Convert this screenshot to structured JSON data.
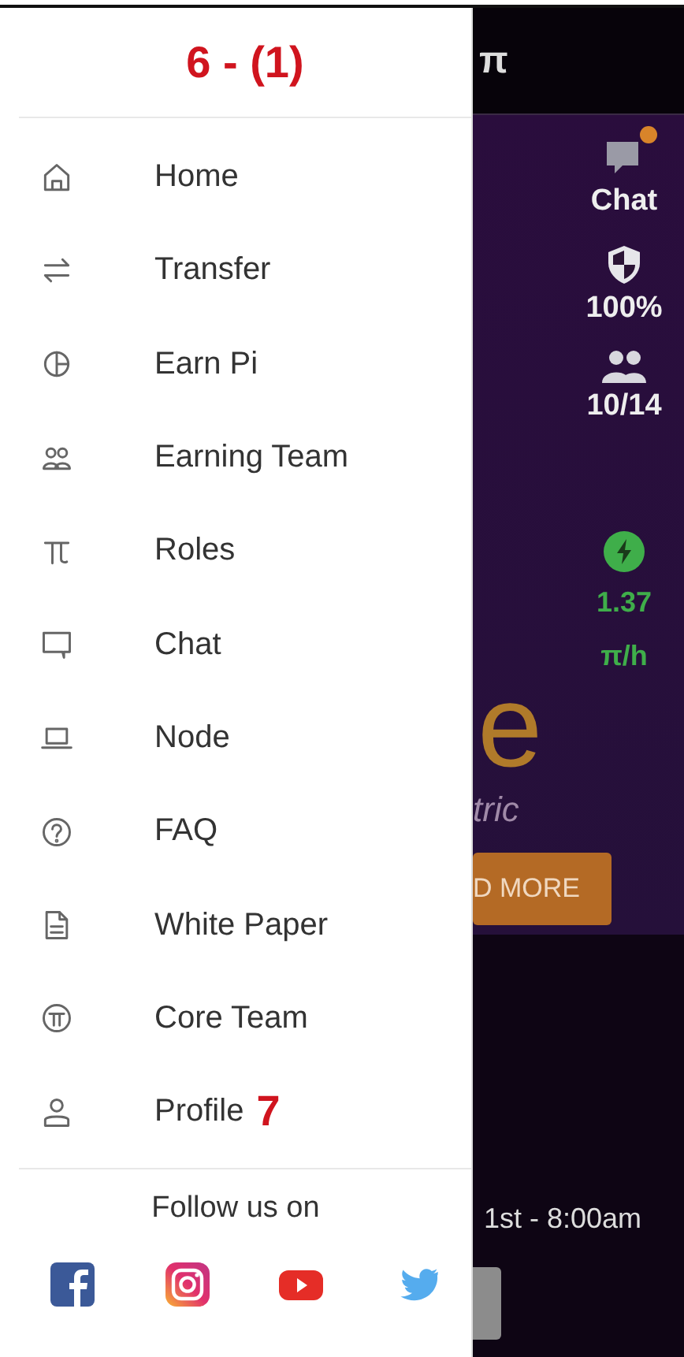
{
  "drawer": {
    "annotation": "6 - (1)",
    "items": [
      {
        "label": "Home",
        "kind": "home"
      },
      {
        "label": "Transfer",
        "kind": "transfer"
      },
      {
        "label": "Earn Pi",
        "kind": "earn"
      },
      {
        "label": "Earning Team",
        "kind": "team"
      },
      {
        "label": "Roles",
        "kind": "pi"
      },
      {
        "label": "Chat",
        "kind": "chat"
      },
      {
        "label": "Node",
        "kind": "laptop"
      },
      {
        "label": "FAQ",
        "kind": "help"
      },
      {
        "label": "White Paper",
        "kind": "document"
      },
      {
        "label": "Core Team",
        "kind": "coin"
      },
      {
        "label": "Profile",
        "kind": "profile",
        "annotation": "7"
      }
    ],
    "follow_label": "Follow us on",
    "social": [
      {
        "kind": "facebook"
      },
      {
        "kind": "instagram"
      },
      {
        "kind": "youtube"
      },
      {
        "kind": "twitter"
      }
    ]
  },
  "background": {
    "header_symbol": "π",
    "stats": [
      {
        "kind": "chat",
        "lines": [
          "Chat"
        ],
        "notification": true
      },
      {
        "kind": "security",
        "lines": [
          "100%"
        ]
      },
      {
        "kind": "team",
        "lines": [
          "10/14"
        ]
      },
      {
        "kind": "mining",
        "lines": [
          "1.37",
          "π/h"
        ]
      }
    ],
    "hero_title": "e",
    "hero_subtitle": "tric",
    "button_label": "D MORE",
    "date": "1st - 8:00am"
  }
}
